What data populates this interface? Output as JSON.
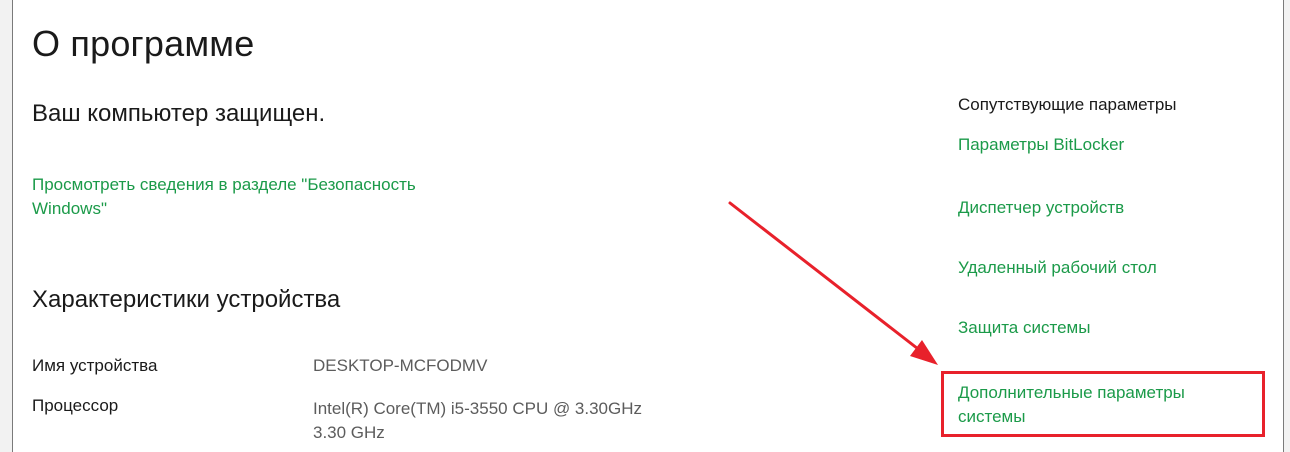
{
  "page": {
    "title": "О программе"
  },
  "protection": {
    "status": "Ваш компьютер защищен.",
    "link_line1": "Просмотреть сведения в разделе \"Безопасность",
    "link_line2": "Windows\""
  },
  "specs": {
    "heading": "Характеристики устройства",
    "rows": [
      {
        "label": "Имя устройства",
        "value": "DESKTOP-MCFODMV"
      },
      {
        "label": "Процессор",
        "value_line1": "Intel(R) Core(TM) i5-3550 CPU @ 3.30GHz",
        "value_line2": "3.30 GHz"
      }
    ]
  },
  "related": {
    "heading": "Сопутствующие параметры",
    "links": [
      "Параметры BitLocker",
      "Диспетчер устройств",
      "Удаленный рабочий стол",
      "Защита системы"
    ],
    "advanced_line1": "Дополнительные параметры",
    "advanced_line2": "системы"
  },
  "annotation": {
    "color": "#e8212b"
  },
  "colors": {
    "link": "#1b9a49",
    "text": "#1a1a1a",
    "muted": "#5c5c5c"
  }
}
